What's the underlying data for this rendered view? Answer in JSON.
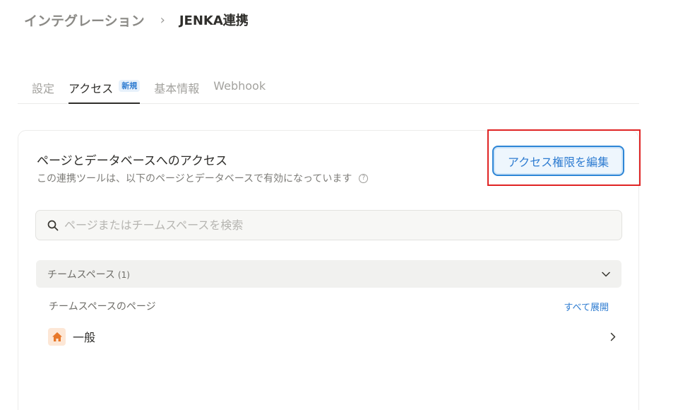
{
  "breadcrumb": {
    "parent": "インテグレーション",
    "separator": "›",
    "current": "JENKA連携"
  },
  "tabs": [
    {
      "label": "設定",
      "active": false
    },
    {
      "label": "アクセス",
      "active": true,
      "badge": "新規"
    },
    {
      "label": "基本情報",
      "active": false
    },
    {
      "label": "Webhook",
      "active": false
    }
  ],
  "access": {
    "title": "ページとデータベースへのアクセス",
    "description": "この連携ツールは、以下のページとデータベースで有効になっています",
    "help_icon": "question-circle-icon",
    "edit_button": "アクセス権限を編集",
    "search_placeholder": "ページまたはチームスペースを検索",
    "search_icon": "search-icon",
    "teamspace": {
      "title": "チームスペース",
      "count": "(1)",
      "chevron_icon": "chevron-down-icon"
    },
    "subhead": {
      "label": "チームスペースのページ",
      "expand_all": "すべて展開"
    },
    "pages": [
      {
        "name": "一般",
        "icon": "home-icon",
        "chevron_icon": "chevron-right-icon"
      }
    ]
  },
  "colors": {
    "accent": "#2e7cd1",
    "highlight": "#e02424",
    "home_icon": "#e8782a"
  }
}
